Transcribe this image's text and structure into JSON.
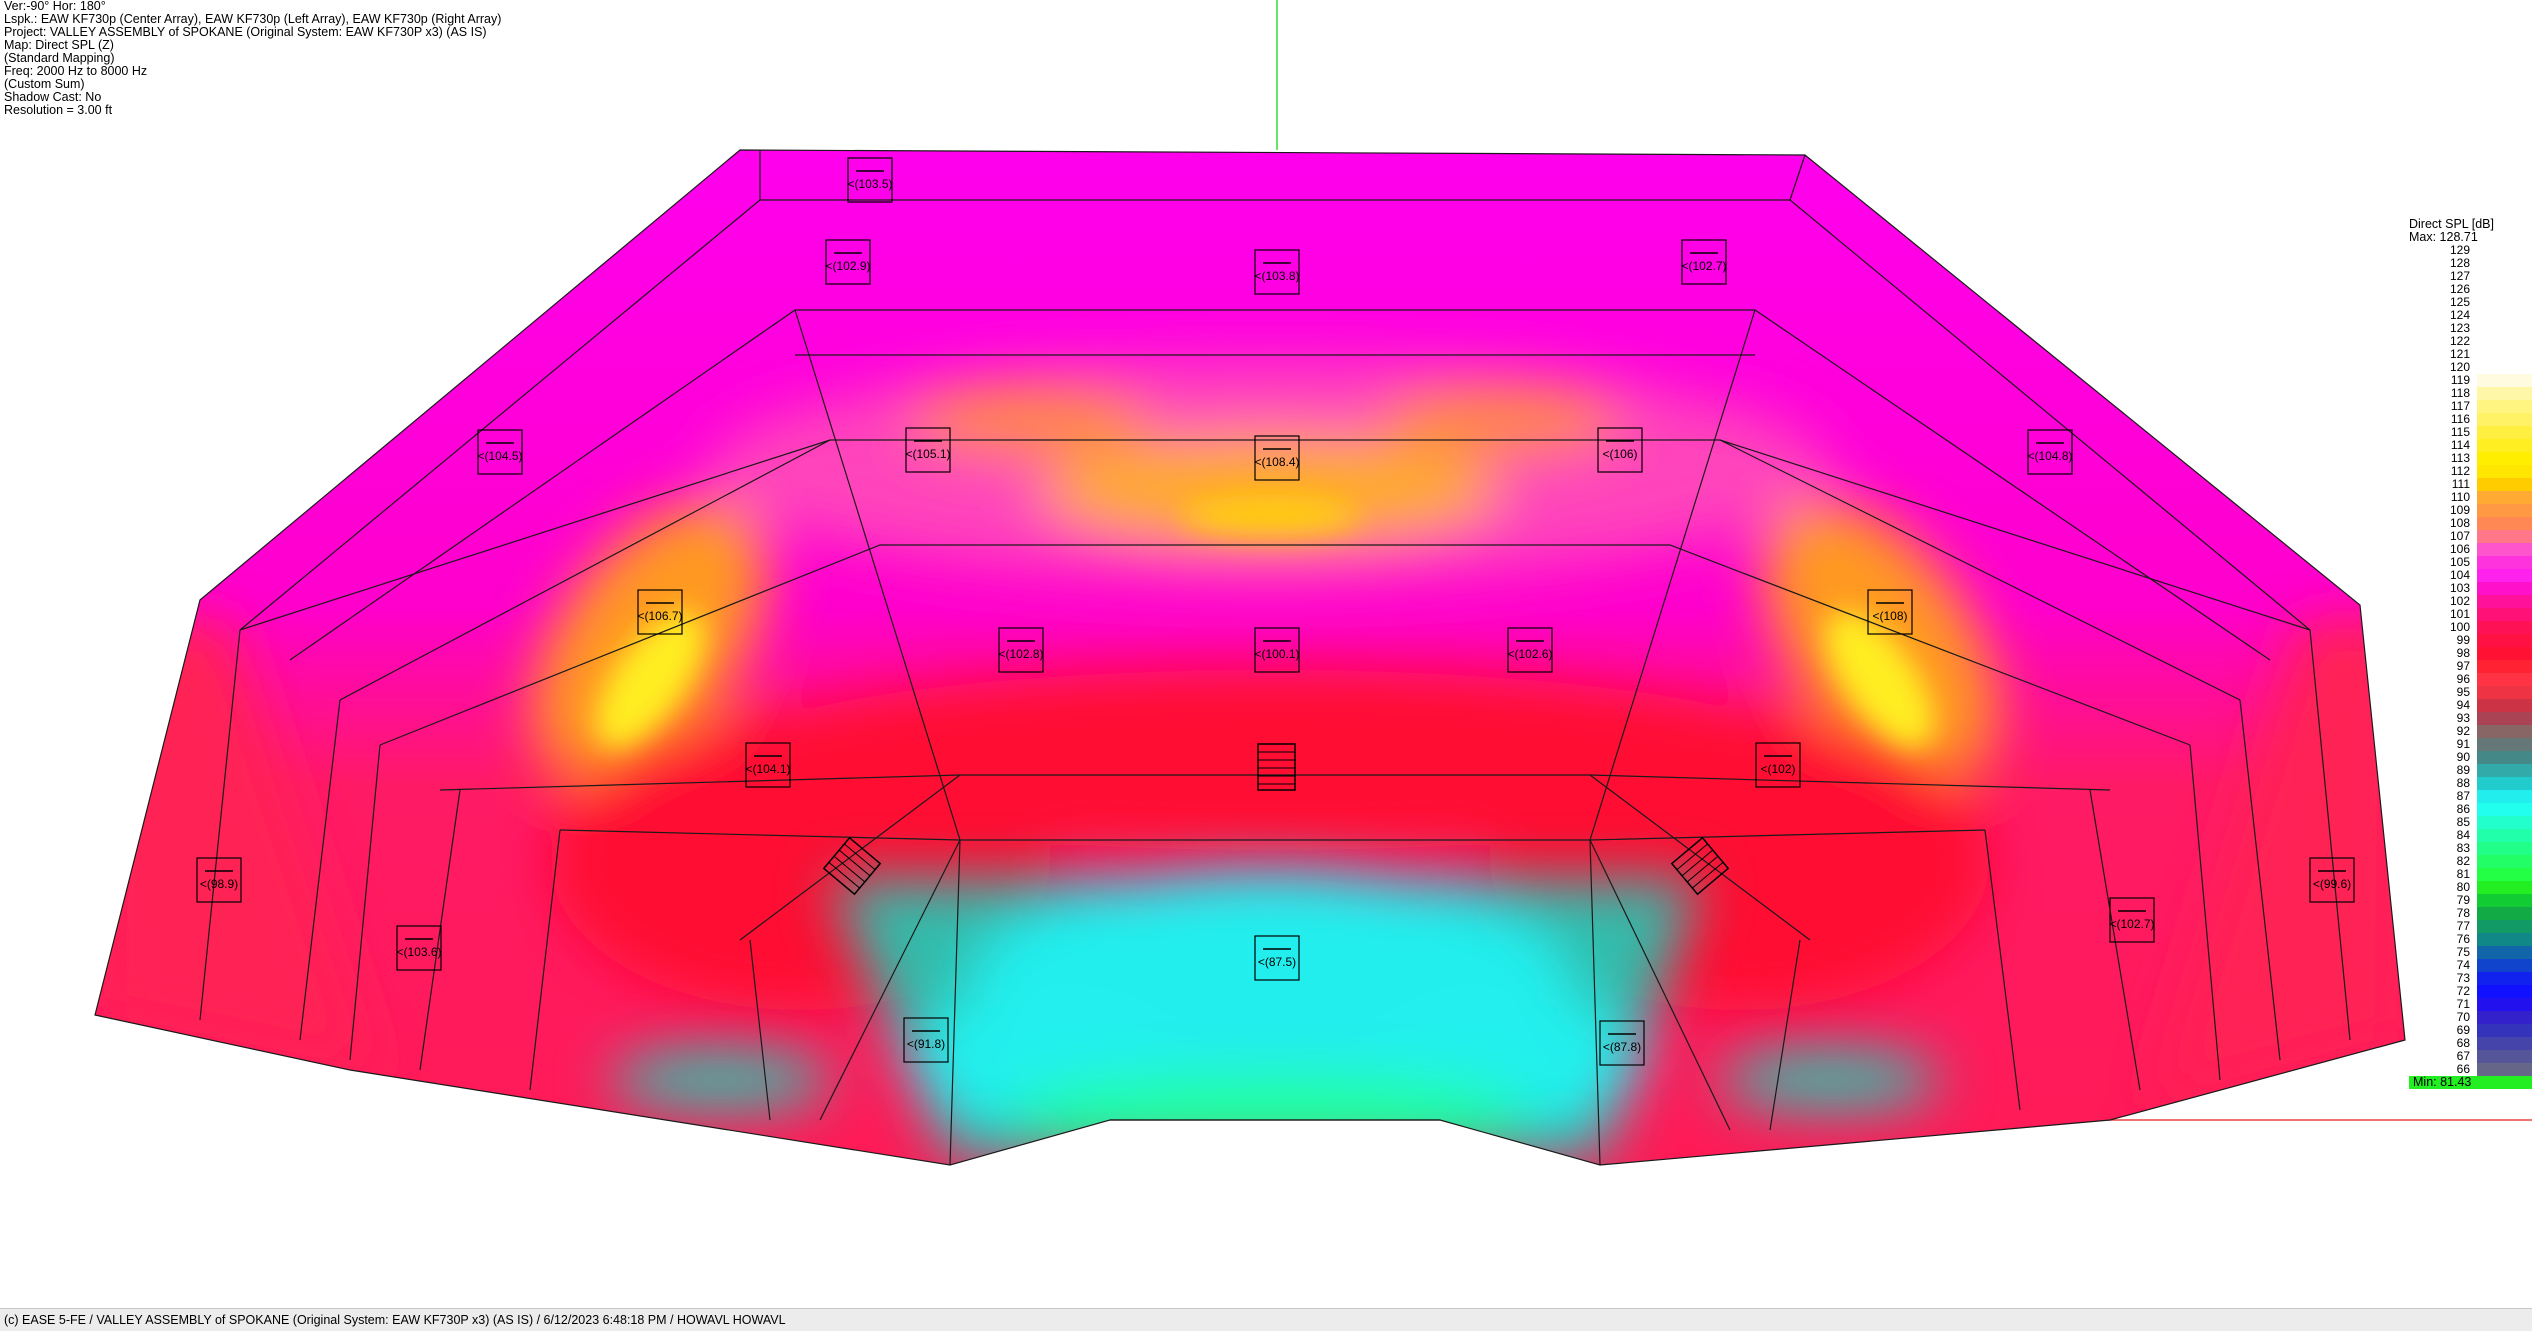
{
  "header": {
    "lines": [
      "Ver:-90°   Hor: 180°",
      "Lspk.: EAW KF730p (Center Array), EAW KF730p (Left Array), EAW KF730p (Right Array)",
      "Project: VALLEY ASSEMBLY of SPOKANE (Original System: EAW KF730P x3) (AS IS)",
      "Map: Direct SPL (Z)",
      "(Standard Mapping)",
      "Freq: 2000 Hz to  8000 Hz",
      "(Custom Sum)",
      "Shadow Cast: No",
      "Resolution =   3.00 ft"
    ]
  },
  "legend": {
    "title": "Direct SPL [dB]",
    "max_label": "Max:  128.71",
    "min_label": "Min:  81.43",
    "min_color": "#22ee22",
    "scale": [
      129,
      128,
      127,
      126,
      125,
      124,
      123,
      122,
      121,
      120,
      119,
      118,
      117,
      116,
      115,
      114,
      113,
      112,
      111,
      110,
      109,
      108,
      107,
      106,
      105,
      104,
      103,
      102,
      101,
      100,
      99,
      98,
      97,
      96,
      95,
      94,
      93,
      92,
      91,
      90,
      89,
      88,
      87,
      86,
      85,
      84,
      83,
      82,
      81,
      80,
      79,
      78,
      77,
      76,
      75,
      74,
      73,
      72,
      71,
      70,
      69,
      68,
      67,
      66
    ]
  },
  "markers": [
    {
      "label": "<(103.5)"
    },
    {
      "label": "<(102.9)"
    },
    {
      "label": "<(103.8)"
    },
    {
      "label": "<(102.7)"
    },
    {
      "label": "<(104.5)"
    },
    {
      "label": "<(105.1)"
    },
    {
      "label": "<(108.4)"
    },
    {
      "label": "<(106)"
    },
    {
      "label": "<(104.8)"
    },
    {
      "label": "<(106.7)"
    },
    {
      "label": "<(102.8)"
    },
    {
      "label": "<(100.1)"
    },
    {
      "label": "<(102.6)"
    },
    {
      "label": "<(108)"
    },
    {
      "label": "<(104.1)"
    },
    {
      "label": "<(102)"
    },
    {
      "label": "<(98.9)"
    },
    {
      "label": "<(103.6)"
    },
    {
      "label": "<(87.5)"
    },
    {
      "label": "<(91.8)"
    },
    {
      "label": "<(87.8)"
    },
    {
      "label": "<(102.7)"
    },
    {
      "label": "<(99.6)"
    }
  ],
  "statusbar": {
    "text": "(c) EASE 5-FE   / VALLEY ASSEMBLY of SPOKANE (Original System: EAW KF730P x3) (AS IS)   / 6/12/2023 6:48:18 PM / HOWAVL HOWAVL"
  }
}
